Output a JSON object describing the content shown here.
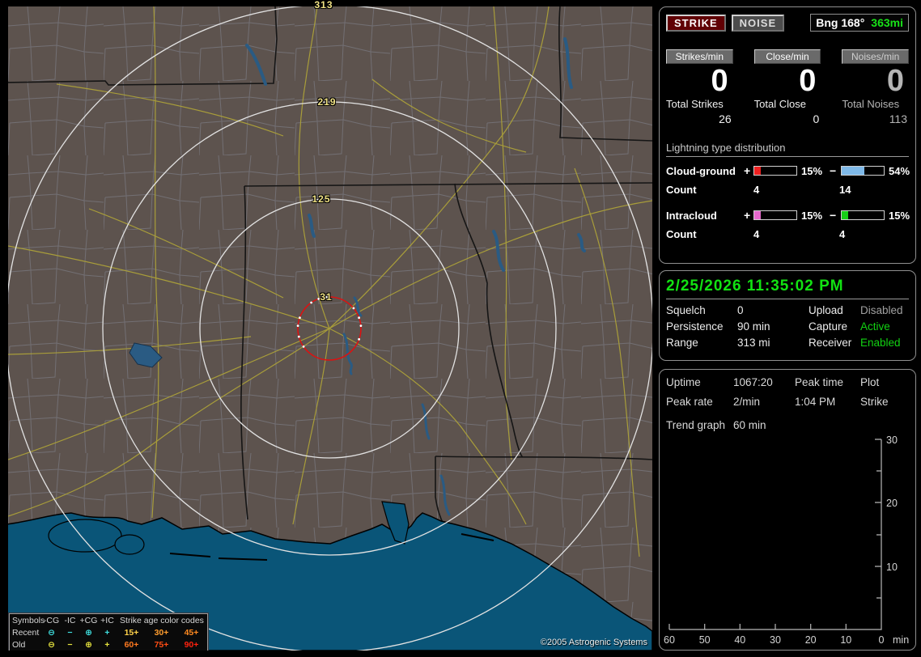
{
  "map": {
    "ring_labels": [
      "313",
      "219",
      "125",
      "31"
    ],
    "copyright": "©2005 Astrogenic Systems",
    "legend": {
      "symbols_header": "Symbols",
      "symbol_cols": [
        "-CG",
        "-IC",
        "+CG",
        "+IC"
      ],
      "age_header": "Strike age color codes",
      "recent_label": "Recent",
      "old_label": "Old",
      "glyphs": {
        "circle_minus": "⊖",
        "minus": "−",
        "circle_plus": "⊕",
        "plus": "+"
      },
      "recent_color": "#3fe0e0",
      "old_color": "#e6e33e",
      "recent_ages": [
        {
          "text": "15+",
          "color": "#ffd24a"
        },
        {
          "text": "30+",
          "color": "#ff9d2e"
        },
        {
          "text": "45+",
          "color": "#ff8a20"
        }
      ],
      "old_ages": [
        {
          "text": "60+",
          "color": "#ff7a20"
        },
        {
          "text": "75+",
          "color": "#ff4d14"
        },
        {
          "text": "90+",
          "color": "#ff220e"
        }
      ]
    }
  },
  "panel_counters": {
    "strike_button": "STRIKE",
    "noise_button": "NOISE",
    "bearing_label": "Bng 168°",
    "bearing_range": "363mi",
    "columns": [
      {
        "rate_label": "Strikes/min",
        "rate": "0",
        "total_label": "Total Strikes",
        "total": "26"
      },
      {
        "rate_label": "Close/min",
        "rate": "0",
        "total_label": "Total Close",
        "total": "0"
      },
      {
        "rate_label": "Noises/min",
        "rate": "0",
        "total_label": "Total Noises",
        "total": "113"
      }
    ],
    "distribution_title": "Lightning type distribution",
    "distribution_rows": [
      {
        "label": "Cloud-ground",
        "plus_sign": "+",
        "plus_pct": "15%",
        "plus_fill": 15,
        "plus_color": "#ee2020",
        "minus_sign": "−",
        "minus_pct": "54%",
        "minus_fill": 54,
        "minus_color": "#7fb9e8",
        "count_label": "Count",
        "plus_count": "4",
        "minus_count": "14"
      },
      {
        "label": "Intracloud",
        "plus_sign": "+",
        "plus_pct": "15%",
        "plus_fill": 15,
        "plus_color": "#e468cb",
        "minus_sign": "−",
        "minus_pct": "15%",
        "minus_fill": 15,
        "minus_color": "#17cf17",
        "count_label": "Count",
        "plus_count": "4",
        "minus_count": "4"
      }
    ]
  },
  "panel_status": {
    "datetime": "2/25/2026 11:35:02 PM",
    "rows": [
      {
        "label1": "Squelch",
        "value1": "0",
        "label2": "Upload",
        "value2": "Disabled",
        "value2_state": "dim"
      },
      {
        "label1": "Persistence",
        "value1": "90 min",
        "label2": "Capture",
        "value2": "Active",
        "value2_state": "green"
      },
      {
        "label1": "Range",
        "value1": "313 mi",
        "label2": "Receiver",
        "value2": "Enabled",
        "value2_state": "green"
      }
    ]
  },
  "panel_trend": {
    "info_rows": [
      {
        "c1": "Uptime",
        "c2": "1067:20",
        "c3": "Peak time",
        "c4": "Plot"
      },
      {
        "c1": "Peak rate",
        "c2": "2/min",
        "c3": "1:04 PM",
        "c4": "Strike"
      }
    ],
    "trend_label": "Trend graph",
    "trend_value": "60 min"
  },
  "chart_data": {
    "type": "line",
    "title": "Strike trend graph",
    "xlabel": "min",
    "x_ticks": [
      "60",
      "50",
      "40",
      "30",
      "20",
      "10",
      "0"
    ],
    "x_unit": "min",
    "y_ticks": [
      "30",
      "20",
      "10"
    ],
    "ylim": [
      0,
      30
    ],
    "xlim_minutes_ago": [
      60,
      0
    ],
    "series": [
      {
        "name": "Strike",
        "values": []
      }
    ]
  }
}
